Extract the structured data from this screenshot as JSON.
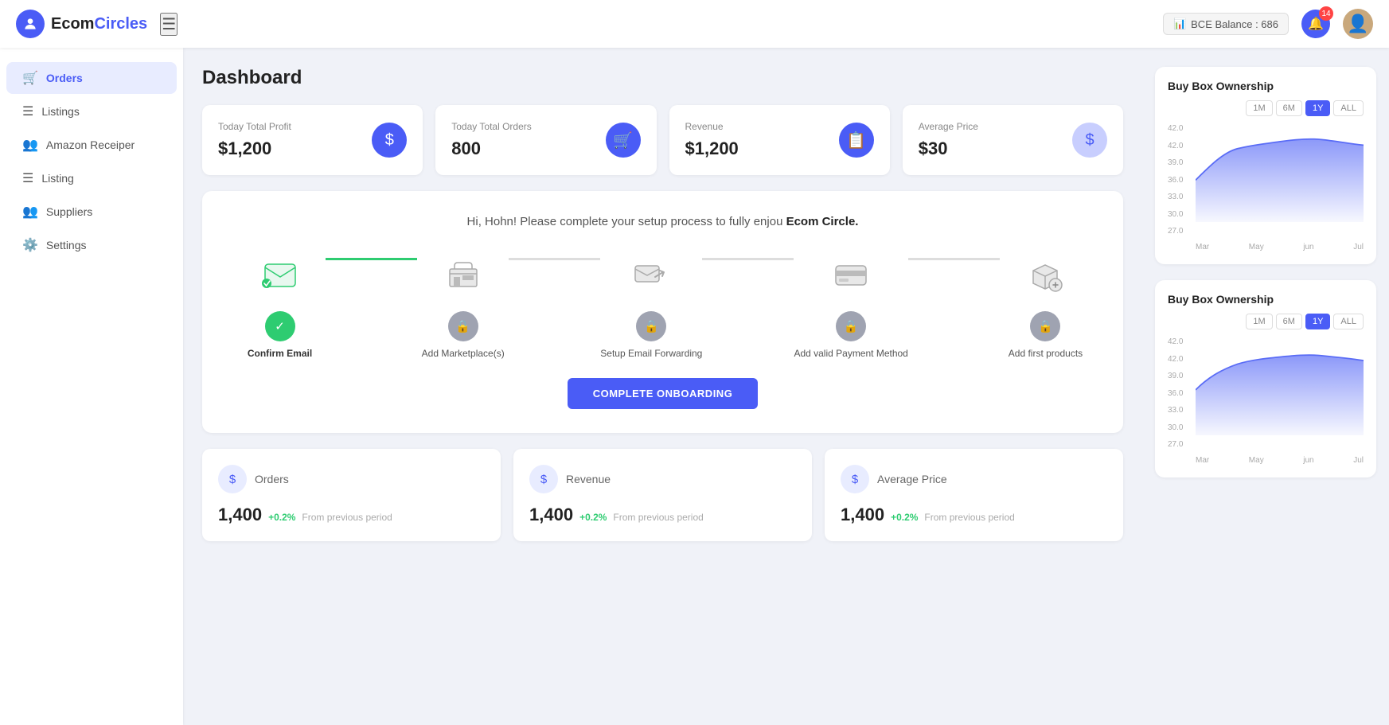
{
  "logo": {
    "text_bold": "Ecom",
    "text_light": "Circles",
    "icon": "🏠"
  },
  "topnav": {
    "hamburger_label": "☰",
    "bce_label": "BCE Balance : 686",
    "notification_count": "14",
    "avatar_initial": "👤"
  },
  "sidebar": {
    "items": [
      {
        "id": "orders",
        "label": "Orders",
        "icon": "🛒",
        "active": true
      },
      {
        "id": "listings",
        "label": "Listings",
        "icon": "☰",
        "active": false
      },
      {
        "id": "amazon-receiper",
        "label": "Amazon Receiper",
        "icon": "👥",
        "active": false
      },
      {
        "id": "listing",
        "label": "Listing",
        "icon": "☰",
        "active": false
      },
      {
        "id": "suppliers",
        "label": "Suppliers",
        "icon": "👥",
        "active": false
      },
      {
        "id": "settings",
        "label": "Settings",
        "icon": "⚙️",
        "active": false
      }
    ]
  },
  "page": {
    "title": "Dashboard"
  },
  "stats": [
    {
      "label": "Today Total Profit",
      "value": "$1,200",
      "icon": "$"
    },
    {
      "label": "Today Total Orders",
      "value": "800",
      "icon": "🛒"
    },
    {
      "label": "Revenue",
      "value": "$1,200",
      "icon": "📋"
    },
    {
      "label": "Average Price",
      "value": "$30",
      "icon": "💲"
    }
  ],
  "onboarding": {
    "greeting": "Hi, Hohn! Please complete your setup process to fully enjou ",
    "brand": "Ecom Circle.",
    "steps": [
      {
        "id": "confirm-email",
        "label": "Confirm Email",
        "icon": "✉️",
        "status": "done"
      },
      {
        "id": "add-marketplace",
        "label": "Add Marketplace(s)",
        "icon": "🏪",
        "status": "locked"
      },
      {
        "id": "setup-email-forwarding",
        "label": "Setup Email Forwarding",
        "icon": "📧",
        "status": "locked"
      },
      {
        "id": "add-payment",
        "label": "Add valid Payment Method",
        "icon": "💳",
        "status": "locked"
      },
      {
        "id": "add-products",
        "label": "Add first products",
        "icon": "📦",
        "status": "locked"
      }
    ],
    "button_label": "COMPLETE ONBOARDING"
  },
  "bottom_stats": [
    {
      "label": "Orders",
      "value": "1,400",
      "change": "+0.2%",
      "period": "From previous period"
    },
    {
      "label": "Revenue",
      "value": "1,400",
      "change": "+0.2%",
      "period": "From previous period"
    },
    {
      "label": "Average Price",
      "value": "1,400",
      "change": "+0.2%",
      "period": "From previous period"
    }
  ],
  "charts": [
    {
      "title": "Buy Box Ownership",
      "filters": [
        "1M",
        "6M",
        "1Y",
        "ALL"
      ],
      "active_filter": "1Y",
      "y_labels": [
        "42.0",
        "42.0",
        "39.0",
        "36.0",
        "33.0",
        "30.0",
        "27.0"
      ],
      "x_labels": [
        "Mar",
        "May",
        "jun",
        "Jul"
      ]
    },
    {
      "title": "Buy Box Ownership",
      "filters": [
        "1M",
        "6M",
        "1Y",
        "ALL"
      ],
      "active_filter": "1Y",
      "y_labels": [
        "42.0",
        "42.0",
        "39.0",
        "36.0",
        "33.0",
        "30.0",
        "27.0"
      ],
      "x_labels": [
        "Mar",
        "May",
        "jun",
        "Jul"
      ]
    }
  ]
}
